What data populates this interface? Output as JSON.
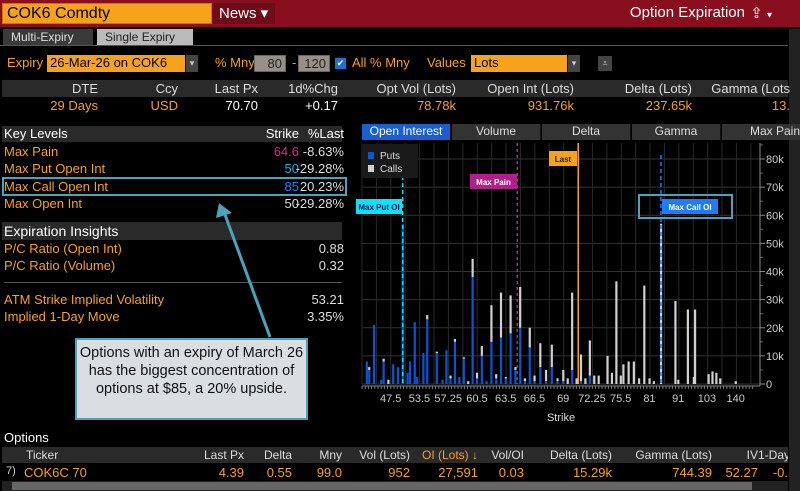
{
  "header": {
    "ticker": "COK6 Comdty",
    "news": "News ▾",
    "app_title": "Option Expiration",
    "share_icon": "share-icon"
  },
  "tabs": [
    "Multi-Expiry",
    "Single Expiry"
  ],
  "controls": {
    "expiry_label": "Expiry",
    "expiry_value": "26-Mar-26 on COK6",
    "mny_label": "% Mny",
    "mny_low": "80",
    "mny_sep": "-",
    "mny_high": "120",
    "all_mny_label": "All % Mny",
    "all_mny_checked": true,
    "values_label": "Values",
    "values_value": "Lots"
  },
  "summary": {
    "headers": [
      "DTE",
      "Ccy",
      "Last Px",
      "1d%Chg",
      "Opt Vol (Lots)",
      "Open Int (Lots)",
      "Delta (Lots)",
      "Gamma (Lots"
    ],
    "values": [
      "29 Days",
      "USD",
      "70.70",
      "+0.17",
      "78.78k",
      "931.76k",
      "237.65k",
      "13."
    ]
  },
  "key_levels": {
    "header": [
      "Key Levels",
      "Strike",
      "%Last"
    ],
    "rows": [
      {
        "label": "Max Pain",
        "strike": "64.6",
        "pct": "-8.63%",
        "color": "#e8208a"
      },
      {
        "label": "Max Put Open Int",
        "strike": "50",
        "pct": "-29.28%",
        "color": "#17b3e6"
      },
      {
        "label": "Max Call Open Int",
        "strike": "85",
        "pct": "20.23%",
        "color": "#2a7cff"
      },
      {
        "label": "Max Open Int",
        "strike": "50",
        "pct": "-29.28%",
        "color": "#dddddd"
      }
    ]
  },
  "insights": {
    "header": "Expiration Insights",
    "rows": [
      {
        "label": "P/C Ratio (Open Int)",
        "value": "0.88"
      },
      {
        "label": "P/C Ratio (Volume)",
        "value": "0.32"
      },
      {
        "label": "ATM Strike Implied Volatility",
        "value": "53.21"
      },
      {
        "label": "Implied 1-Day Move",
        "value": "3.35%"
      }
    ]
  },
  "callout": "Options with an expiry of March 26 has the biggest concentration of options at $85, a 20% upside.",
  "chart_tabs": [
    "Open Interest",
    "Volume",
    "Delta",
    "Gamma",
    "Max Pain"
  ],
  "chart_data": {
    "type": "bar",
    "stacked": true,
    "xlabel": "Strike",
    "ylabel": "",
    "ylim": [
      0,
      85000
    ],
    "yticks": [
      0,
      10000,
      20000,
      30000,
      40000,
      50000,
      60000,
      70000,
      80000
    ],
    "ytick_labels": [
      "0",
      "10k",
      "20k",
      "30k",
      "40k",
      "50k",
      "60k",
      "70k",
      "80k"
    ],
    "xtick_labels": [
      "47.5",
      "53.5",
      "57.25",
      "60.5",
      "63.5",
      "66.5",
      "69",
      "72.25",
      "75.5",
      "81",
      "91",
      "103",
      "140"
    ],
    "grid": true,
    "legend": "top-left",
    "series_names": [
      "Puts",
      "Calls"
    ],
    "colors": {
      "Puts": "#0a55d0",
      "Calls": "#d0d0d0"
    },
    "bars": [
      [
        42.5,
        8,
        0
      ],
      [
        43,
        5,
        1
      ],
      [
        44,
        21,
        0
      ],
      [
        45.5,
        1.5,
        0
      ],
      [
        46,
        8,
        1
      ],
      [
        47,
        0,
        1.5
      ],
      [
        48,
        7,
        0
      ],
      [
        49,
        6,
        0
      ],
      [
        50,
        57,
        0
      ],
      [
        51,
        4,
        0
      ],
      [
        51.5,
        8,
        0
      ],
      [
        52.5,
        22,
        0
      ],
      [
        53,
        2.5,
        0
      ],
      [
        54,
        11,
        0
      ],
      [
        54.5,
        23,
        1.5
      ],
      [
        55.75,
        11,
        0.5
      ],
      [
        56.5,
        1.5,
        0
      ],
      [
        57,
        12,
        0
      ],
      [
        57.5,
        2,
        1
      ],
      [
        58,
        15,
        1
      ],
      [
        58.5,
        2.5,
        0
      ],
      [
        59,
        9,
        0.5
      ],
      [
        59.5,
        0,
        1
      ],
      [
        60,
        38,
        6.5
      ],
      [
        60.5,
        2,
        2
      ],
      [
        61,
        10,
        3.5
      ],
      [
        61.5,
        1,
        0
      ],
      [
        62,
        15,
        13
      ],
      [
        62.5,
        2,
        1.5
      ],
      [
        63,
        16.5,
        16
      ],
      [
        63.5,
        2,
        0.5
      ],
      [
        64,
        18,
        13.5
      ],
      [
        64.5,
        5,
        1
      ],
      [
        65,
        20,
        14.5
      ],
      [
        65.5,
        1,
        1
      ],
      [
        66,
        13,
        7
      ],
      [
        66.5,
        1,
        2
      ],
      [
        67,
        6,
        8.5
      ],
      [
        67.5,
        1,
        4
      ],
      [
        68,
        6,
        8
      ],
      [
        68.5,
        1,
        1
      ],
      [
        69,
        1,
        4
      ],
      [
        69.5,
        0,
        2
      ],
      [
        70,
        5,
        27.5
      ],
      [
        70.5,
        0,
        2
      ],
      [
        71,
        1,
        9.5
      ],
      [
        71.5,
        0,
        2
      ],
      [
        72,
        3,
        12.5
      ],
      [
        72.5,
        0,
        3
      ],
      [
        73,
        0,
        3
      ],
      [
        74,
        0,
        10
      ],
      [
        74.5,
        0,
        4
      ],
      [
        75,
        0,
        36.5
      ],
      [
        75.5,
        0,
        3
      ],
      [
        76,
        0,
        7
      ],
      [
        77,
        0,
        8
      ],
      [
        78,
        0,
        8
      ],
      [
        79,
        0,
        2
      ],
      [
        80,
        0,
        35
      ],
      [
        81,
        0,
        2
      ],
      [
        82.5,
        0,
        1
      ],
      [
        85,
        0,
        57
      ],
      [
        90,
        0,
        29.5
      ],
      [
        91,
        0,
        1.5
      ],
      [
        95,
        0,
        26.5
      ],
      [
        97.5,
        0,
        2.5
      ],
      [
        98,
        0,
        26.5
      ],
      [
        105,
        0,
        3.5
      ],
      [
        110,
        0,
        4.5
      ],
      [
        115,
        0,
        4
      ],
      [
        120,
        0,
        2
      ],
      [
        140,
        0,
        1
      ]
    ],
    "bar_units": "thousands of lots",
    "markers": [
      {
        "label": "Max Put OI",
        "strike": 50,
        "color": "#00e5ff"
      },
      {
        "label": "Max Pain",
        "strike": 64.6,
        "color": "#c0208a"
      },
      {
        "label": "Last",
        "strike": 70.7,
        "color": "#f7a21b"
      },
      {
        "label": "Max Call OI",
        "strike": 85,
        "color": "#1f7cff"
      }
    ],
    "marker_labels": {
      "put": "ax Put OI",
      "pain": "Max Pain",
      "last": "Last",
      "call": "Max Call OI"
    }
  },
  "options": {
    "title": "Options",
    "headers": [
      "Ticker",
      "Last Px",
      "Delta",
      "Mny",
      "Vol (Lots)",
      "OI (Lots) ↓",
      "Vol/OI",
      "Delta (Lots)",
      "Gamma (Lots)",
      "IV",
      "1-Day"
    ],
    "rows": [
      {
        "idx": "7)",
        "ticker": "COK6C 70",
        "last": "4.39",
        "delta": "0.55",
        "mny": "99.0",
        "vol": "952",
        "oi": "27,591",
        "voloi": "0.03",
        "delta_lots": "15.29k",
        "gamma": "744.39",
        "iv": "52.27",
        "oneday": "-0."
      }
    ]
  }
}
